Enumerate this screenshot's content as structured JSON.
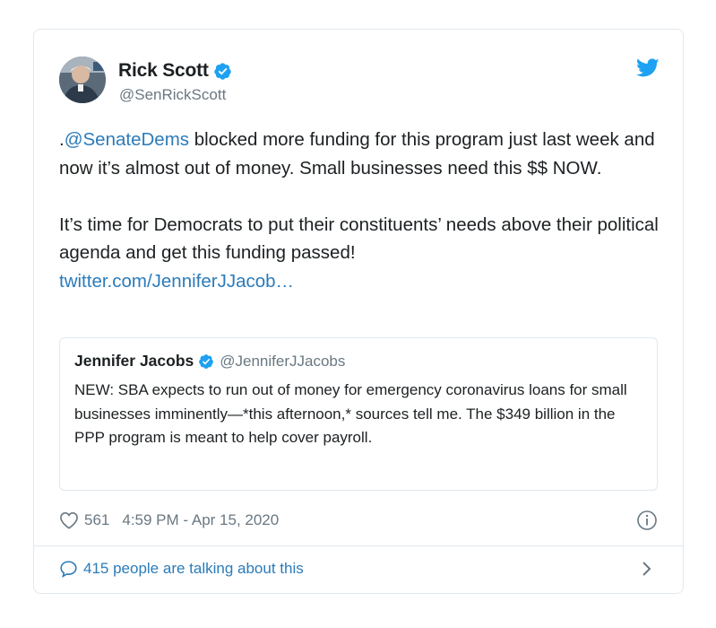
{
  "author": {
    "name": "Rick Scott",
    "handle": "@SenRickScott"
  },
  "tweet": {
    "mention": "@SenateDems",
    "paragraph1_prefix": ".",
    "paragraph1_rest": " blocked more funding for this program just last week and now it’s almost out of money. Small businesses need this $$ NOW.",
    "paragraph2": "It’s time for Democrats to put their constituents’ needs above their political agenda and get this funding passed!",
    "link": "twitter.com/JenniferJJacob…"
  },
  "quote": {
    "name": "Jennifer Jacobs",
    "handle": "@JenniferJJacobs",
    "text": "NEW: SBA expects to run out of money for emergency coronavirus loans for small businesses imminently—*this afternoon,* sources tell me. The $349 billion in the PPP program is meant to help cover payroll."
  },
  "meta": {
    "likes": "561",
    "timestamp": "4:59 PM - Apr 15, 2020"
  },
  "footer": {
    "talking": "415 people are talking about this"
  },
  "colors": {
    "link": "#2b7bb9",
    "verified": "#1da1f2",
    "muted": "#697882",
    "border": "#e1e8ed"
  },
  "icons": [
    "twitter-bird-icon",
    "verified-badge-icon",
    "heart-icon",
    "info-icon",
    "reply-bubble-icon",
    "chevron-right-icon"
  ]
}
